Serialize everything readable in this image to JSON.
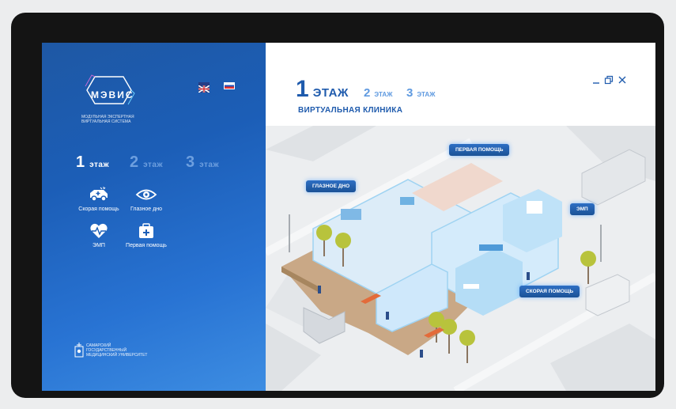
{
  "sidebar": {
    "logo": {
      "name": "МЭВИС",
      "tagline": "МОДУЛЬНАЯ ЭКСПЕРТНАЯ ВИРТУАЛЬНАЯ СИСТЕМА"
    },
    "languages": [
      "English",
      "Русский"
    ],
    "floors": [
      {
        "num": "1",
        "label": "этаж",
        "active": true
      },
      {
        "num": "2",
        "label": "этаж",
        "active": false
      },
      {
        "num": "3",
        "label": "этаж",
        "active": false
      }
    ],
    "menu": [
      {
        "label": "Скорая помощь",
        "icon": "ambulance-icon"
      },
      {
        "label": "Глазное дно",
        "icon": "eye-icon"
      },
      {
        "label": "ЭМП",
        "icon": "heart-pulse-icon"
      },
      {
        "label": "Первая помощь",
        "icon": "first-aid-kit-icon"
      }
    ],
    "university": "САМАРСКИЙ ГОСУДАРСТВЕННЫЙ МЕДИЦИНСКИЙ УНИВЕРСИТЕТ"
  },
  "main": {
    "tabs": [
      {
        "num": "1",
        "label": "ЭТАЖ",
        "active": true
      },
      {
        "num": "2",
        "label": "ЭТАЖ",
        "active": false
      },
      {
        "num": "3",
        "label": "ЭТАЖ",
        "active": false
      }
    ],
    "subtitle": "ВИРТУАЛЬНАЯ КЛИНИКА",
    "window_controls": [
      "minimize-icon",
      "restore-icon",
      "close-icon"
    ],
    "map_labels": [
      {
        "label": "ПЕРВАЯ ПОМОЩЬ"
      },
      {
        "label": "ГЛАЗНОЕ ДНО"
      },
      {
        "label": "ЭМП"
      },
      {
        "label": "СКОРАЯ ПОМОЩЬ"
      }
    ]
  },
  "colors": {
    "panel_blue": "#1c5eb7",
    "accent_dark_blue": "#1f5bad",
    "accent_light_blue": "#5f9ae0",
    "callout_blue": "#1b5296"
  }
}
